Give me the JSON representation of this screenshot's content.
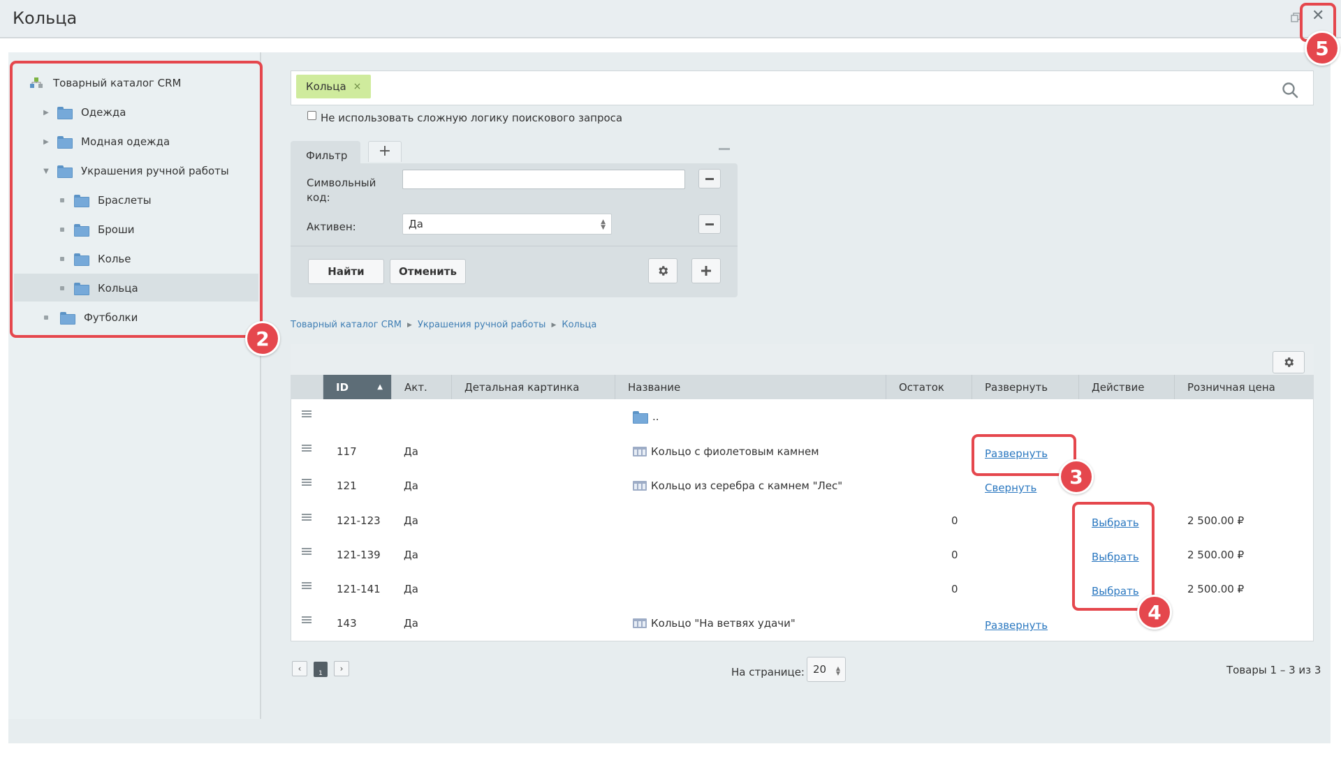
{
  "window": {
    "title": "Кольца"
  },
  "tree": {
    "root": "Товарный каталог CRM",
    "items": [
      {
        "label": "Одежда"
      },
      {
        "label": "Модная одежда"
      },
      {
        "label": "Украшения ручной работы"
      },
      {
        "label": "Браслеты"
      },
      {
        "label": "Броши"
      },
      {
        "label": "Колье"
      },
      {
        "label": "Кольца"
      },
      {
        "label": "Футболки"
      }
    ]
  },
  "search": {
    "tag": "Кольца",
    "tag_remove": "×",
    "logic_label": "Не использовать сложную логику поискового запроса"
  },
  "filter": {
    "tab_label": "Фильтр",
    "add_tab": "+",
    "fields": [
      {
        "label": "Символьный код:",
        "value": ""
      },
      {
        "label": "Активен:",
        "value": "Да"
      }
    ],
    "find_label": "Найти",
    "cancel_label": "Отменить"
  },
  "breadcrumb": [
    "Товарный каталог CRM",
    "Украшения ручной работы",
    "Кольца"
  ],
  "grid": {
    "columns": [
      "ID",
      "Акт.",
      "Детальная картинка",
      "Название",
      "Остаток",
      "Развернуть",
      "Действие",
      "Розничная цена"
    ],
    "up_folder": "..",
    "rows": [
      {
        "id": "117",
        "active": "Да",
        "name": "Кольцо с фиолетовым камнем",
        "stock": "",
        "expand": "Развернуть",
        "action": "",
        "price": ""
      },
      {
        "id": "121",
        "active": "Да",
        "name": "Кольцо из серебра с камнем \"Лес\"",
        "stock": "",
        "expand": "Свернуть",
        "action": "",
        "price": ""
      },
      {
        "id": "121-123",
        "active": "Да",
        "name": "",
        "stock": "0",
        "expand": "",
        "action": "Выбрать",
        "price": "2 500.00 ₽"
      },
      {
        "id": "121-139",
        "active": "Да",
        "name": "",
        "stock": "0",
        "expand": "",
        "action": "Выбрать",
        "price": "2 500.00 ₽"
      },
      {
        "id": "121-141",
        "active": "Да",
        "name": "",
        "stock": "0",
        "expand": "",
        "action": "Выбрать",
        "price": "2 500.00 ₽"
      },
      {
        "id": "143",
        "active": "Да",
        "name": "Кольцо \"На ветвях удачи\"",
        "stock": "",
        "expand": "Развернуть",
        "action": "",
        "price": ""
      }
    ]
  },
  "pager": {
    "current": "1",
    "per_page_label": "На странице:",
    "per_page": "20",
    "count": "Товары 1 – 3 из 3"
  },
  "annotations": [
    "2",
    "3",
    "4",
    "5"
  ],
  "colors": {
    "accent_red": "#e5474d",
    "link": "#2b78c0",
    "tag_green": "#cfeb9d",
    "header_dark": "#5d6d77"
  },
  "icons": [
    "close-icon",
    "restore-window-icon",
    "search-icon",
    "folder-icon",
    "catalog-icon",
    "gear-icon",
    "plus-icon",
    "minus-icon",
    "drag-handle-icon",
    "product-group-icon"
  ]
}
